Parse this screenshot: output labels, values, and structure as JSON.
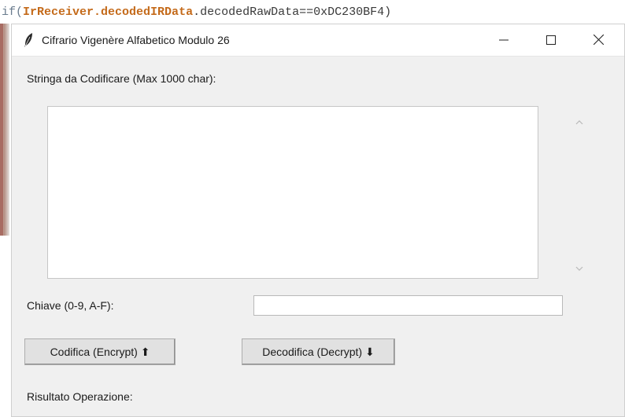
{
  "background": {
    "code_if": "if(",
    "code_receiver": "IrReceiver",
    "code_dot1": ".",
    "code_decoded": "decodedIRData",
    "code_rest": ".decodedRawData==0xDC230BF4)"
  },
  "window": {
    "title": "Cifrario Vigenère Alfabetico Modulo 26",
    "icon": "feather-icon",
    "controls": {
      "minimize": "minimize-icon",
      "maximize": "maximize-icon",
      "close": "close-icon"
    }
  },
  "form": {
    "input_label": "Stringa da Codificare (Max 1000 char):",
    "input_value": "",
    "key_label": "Chiave (0-9, A-F):",
    "key_value": "",
    "encrypt_label": "Codifica (Encrypt) ⬆",
    "decrypt_label": "Decodifica (Decrypt) ⬇",
    "result_label": "Risultato Operazione:"
  },
  "colors": {
    "window_bg": "#f0f0f0",
    "button_bg": "#e1e1e1",
    "code_identifier": "#c46a1a"
  }
}
